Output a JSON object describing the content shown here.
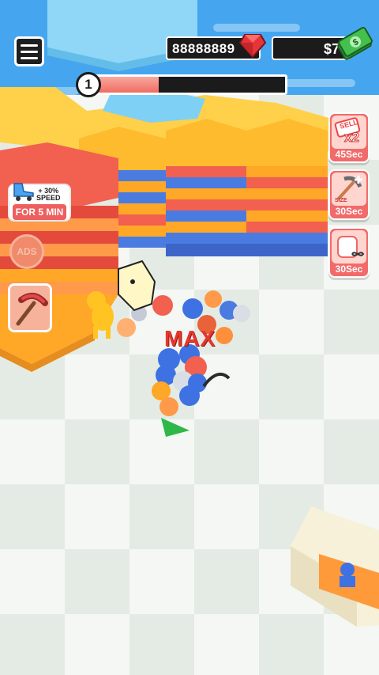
{
  "hud": {
    "gems": "88888889",
    "cash": "$7",
    "level": "1",
    "level_progress": 0.36
  },
  "boosts": {
    "sell_text": "SELL",
    "sell_mult": "x2",
    "sell_timer": "45Sec",
    "size_text": "SIZE",
    "size_timer": "30Sec",
    "capacity_timer": "30Sec"
  },
  "speed_offer": {
    "line1": "+ 30%",
    "line2": "SPEED",
    "button": "FOR 5 MIN"
  },
  "ads_label": "ADS",
  "max_label": "MAX",
  "colors": {
    "accent_red": "#ee5f5f",
    "hex_orange": "#ffb32a",
    "hex_blue": "#4a7be0",
    "hex_red": "#f2604f",
    "water": "#45a6ef"
  }
}
